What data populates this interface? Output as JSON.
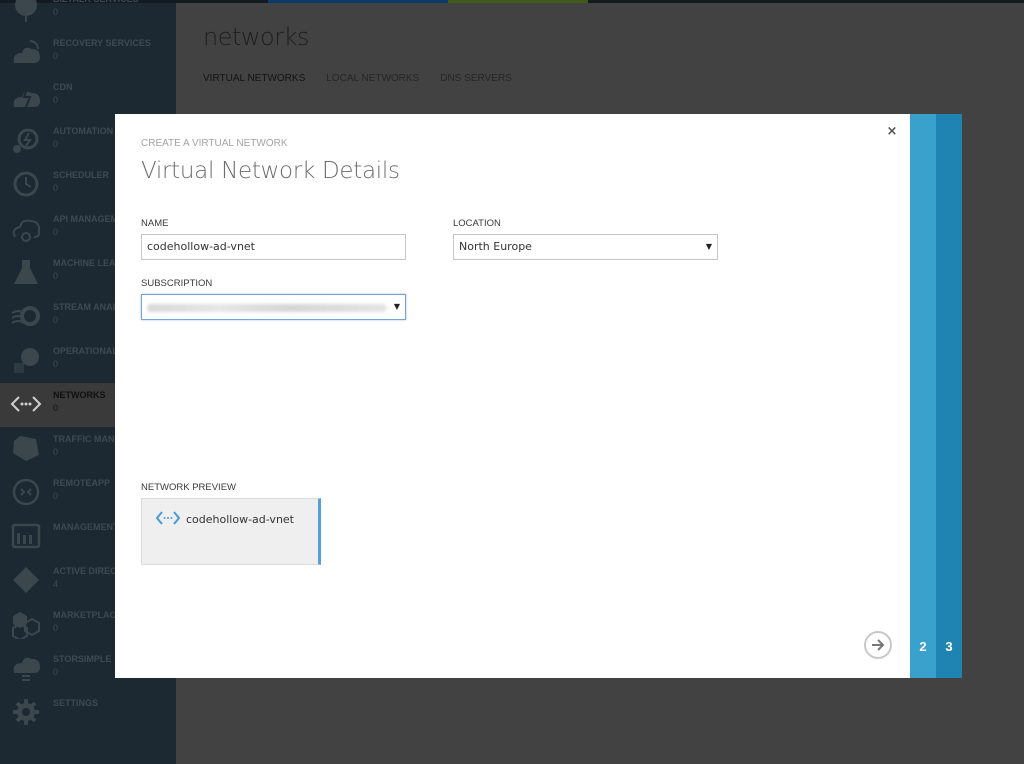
{
  "sidebar": {
    "items": [
      {
        "label": "BIZTALK SERVICES",
        "count": "0",
        "icon": "biztalk-icon"
      },
      {
        "label": "RECOVERY SERVICES",
        "count": "0",
        "icon": "recovery-services-icon"
      },
      {
        "label": "CDN",
        "count": "0",
        "icon": "cdn-icon"
      },
      {
        "label": "AUTOMATION",
        "count": "0",
        "icon": "automation-icon"
      },
      {
        "label": "SCHEDULER",
        "count": "0",
        "icon": "scheduler-icon"
      },
      {
        "label": "API MANAGEMENT",
        "count": "0",
        "icon": "api-management-icon"
      },
      {
        "label": "MACHINE LEARNING",
        "count": "0",
        "icon": "machine-learning-icon"
      },
      {
        "label": "STREAM ANALYTICS",
        "count": "0",
        "icon": "stream-analytics-icon"
      },
      {
        "label": "OPERATIONAL INSIGHTS",
        "count": "0",
        "icon": "operational-insights-icon"
      },
      {
        "label": "NETWORKS",
        "count": "0",
        "icon": "networks-icon",
        "active": true
      },
      {
        "label": "TRAFFIC MANAGER",
        "count": "0",
        "icon": "traffic-manager-icon"
      },
      {
        "label": "REMOTEAPP",
        "count": "0",
        "icon": "remoteapp-icon"
      },
      {
        "label": "MANAGEMENT SERVICES",
        "count": "",
        "icon": "management-services-icon"
      },
      {
        "label": "ACTIVE DIRECTORY",
        "count": "4",
        "icon": "active-directory-icon"
      },
      {
        "label": "MARKETPLACE",
        "count": "0",
        "icon": "marketplace-icon"
      },
      {
        "label": "STORSIMPLE",
        "count": "0",
        "icon": "storsimple-icon"
      },
      {
        "label": "SETTINGS",
        "count": "",
        "icon": "settings-icon"
      }
    ]
  },
  "main": {
    "title": "networks",
    "tabs": [
      {
        "label": "VIRTUAL NETWORKS",
        "active": true
      },
      {
        "label": "LOCAL NETWORKS"
      },
      {
        "label": "DNS SERVERS"
      }
    ]
  },
  "dialog": {
    "kicker": "CREATE A VIRTUAL NETWORK",
    "title": "Virtual Network Details",
    "close_icon": "×",
    "name_label": "NAME",
    "name_value": "codehollow-ad-vnet",
    "location_label": "LOCATION",
    "location_value": "North Europe",
    "subscription_label": "SUBSCRIPTION",
    "subscription_value": "",
    "dropdown_arrow": "▼",
    "preview_label": "NETWORK PREVIEW",
    "preview_name": "codehollow-ad-vnet",
    "steps": [
      "2",
      "3"
    ]
  },
  "colors": {
    "sidebar_bg": "#1c2932",
    "overlay_bg": "#424242",
    "step2": "#3aa0cc",
    "step3": "#1f84b2",
    "accent": "#56a0d8"
  }
}
